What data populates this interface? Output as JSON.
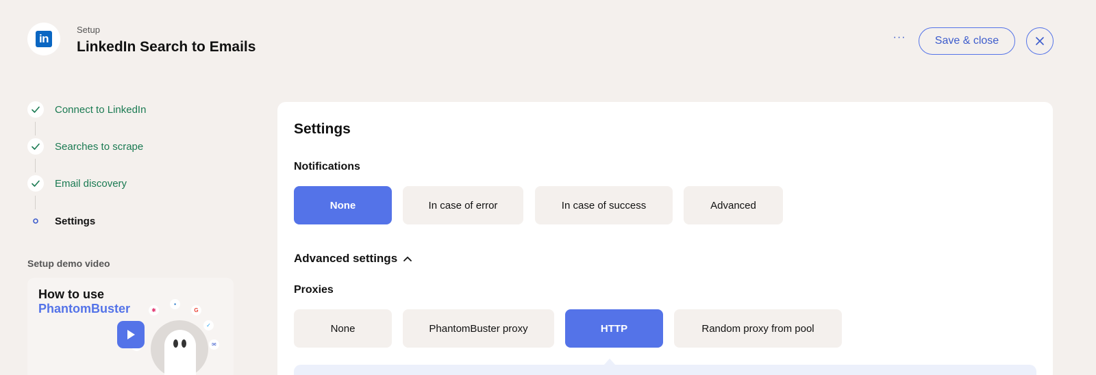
{
  "header": {
    "breadcrumb": "Setup",
    "title": "LinkedIn Search to Emails",
    "logo_text": "in",
    "more_label": "···",
    "save_label": "Save & close",
    "brand_color": "#0a66c2"
  },
  "steps": [
    {
      "label": "Connect to LinkedIn",
      "status": "done",
      "icon": "check-icon"
    },
    {
      "label": "Searches to scrape",
      "status": "done",
      "icon": "check-icon"
    },
    {
      "label": "Email discovery",
      "status": "done",
      "icon": "check-icon"
    },
    {
      "label": "Settings",
      "status": "current",
      "icon": "dot-icon"
    }
  ],
  "demo": {
    "title": "Setup demo video",
    "line1": "How to use",
    "line2": "PhantomBuster"
  },
  "settings": {
    "title": "Settings",
    "notifications": {
      "label": "Notifications",
      "options": [
        "None",
        "In case of error",
        "In case of success",
        "Advanced"
      ],
      "selected": "None"
    },
    "advanced_label": "Advanced settings",
    "proxies": {
      "label": "Proxies",
      "options": [
        "None",
        "PhantomBuster proxy",
        "HTTP",
        "Random proxy from pool"
      ],
      "selected": "HTTP"
    }
  },
  "colors": {
    "accent": "#5473e8",
    "success": "#1a7a52",
    "background": "#f4f0ed"
  }
}
